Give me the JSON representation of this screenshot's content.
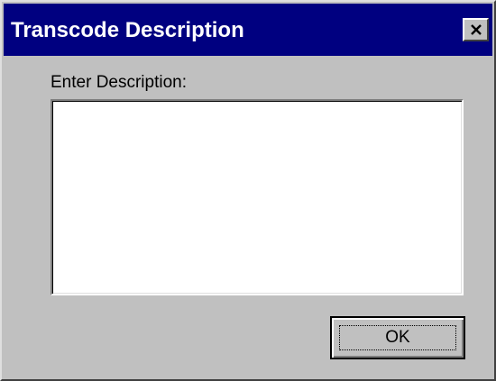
{
  "window": {
    "title": "Transcode Description",
    "close_icon": "close-icon"
  },
  "form": {
    "prompt_label": "Enter Description:",
    "description_value": ""
  },
  "buttons": {
    "ok_label": "OK"
  },
  "colors": {
    "titlebar": "#000080",
    "dialog_face": "#c0c0c0",
    "field_background": "#ffffff"
  }
}
